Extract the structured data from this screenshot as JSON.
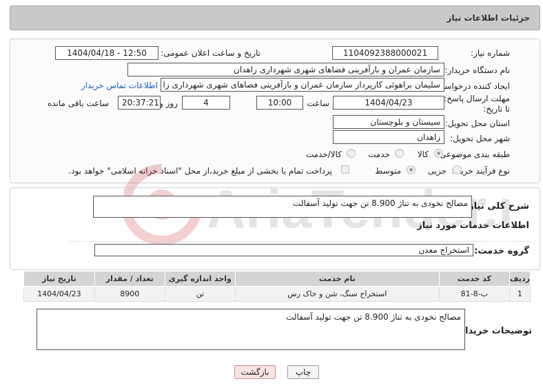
{
  "header": {
    "title": "جزئیات اطلاعات نیاز"
  },
  "form": {
    "need_number_label": "شماره نیاز:",
    "need_number": "1104092388000021",
    "announce_label": "تاریخ و ساعت اعلان عمومی:",
    "announce_value": "1404/04/18 - 12:50",
    "buyer_org_label": "نام دستگاه خریدار:",
    "buyer_org": "سازمان عمران و بازآفرینی فضاهای شهری شهرداری زاهدان",
    "creator_label": "ایجاد کننده درخواست:",
    "creator": "سلیمان براهوئی کارپرداز سازمان عمران و بازآفرینی فضاهای شهری شهرداری زا",
    "contact_link": "اطلاعات تماس خریدار",
    "deadline_label": "مهلت ارسال پاسخ: تا تاریخ:",
    "deadline_date": "1404/04/23",
    "time_label": "ساعت",
    "deadline_time": "10:00",
    "days_value": "4",
    "days_label": "روز و",
    "remaining_time": "20:37:21",
    "remaining_label": "ساعت باقی مانده",
    "province_label": "استان محل تحویل:",
    "province": "سیستان و بلوچستان",
    "city_label": "شهر محل تحویل:",
    "city": "زاهدان",
    "category_label": "طبقه بندی موضوعی:",
    "category_options": [
      "کالا",
      "خدمت",
      "کالا/خدمت"
    ],
    "process_label": "نوع فرآیند خرید :",
    "process_options": [
      "جزیی",
      "متوسط"
    ],
    "payment_note": "پرداخت تمام یا بخشی از مبلغ خرید،از محل \"اسناد خزانه اسلامی\" خواهد بود."
  },
  "summary": {
    "label": "شرح کلی نیاز:",
    "value": "مصالح نخودی به تناژ 8.900 تن جهت تولید آسفالت",
    "services_title": "اطلاعات خدمات مورد نیاز",
    "group_label": "گروه خدمت:",
    "group_value": "استخراج معدن"
  },
  "table": {
    "headers": [
      "ردیف",
      "کد خدمت",
      "نام خدمت",
      "واحد اندازه گیری",
      "تعداد / مقدار",
      "تاریخ نیاز"
    ],
    "rows": [
      [
        "1",
        "ب-8-81",
        "استخراج سنگ، شن و خاک رس",
        "تن",
        "8900",
        "1404/04/23"
      ]
    ]
  },
  "buyer_notes": {
    "label": "توضیحات خریدار:",
    "value": "مصالح نخودی به تناژ 8.900 تن جهت تولید آسفالت"
  },
  "buttons": {
    "print": "چاپ",
    "back": "بازگشت"
  },
  "watermark": {
    "text": "AriaTender.net"
  },
  "colors": {
    "link": "#1f5fbf",
    "header_bg": "#c9c9c9",
    "back_button": "#fbe3e3"
  }
}
